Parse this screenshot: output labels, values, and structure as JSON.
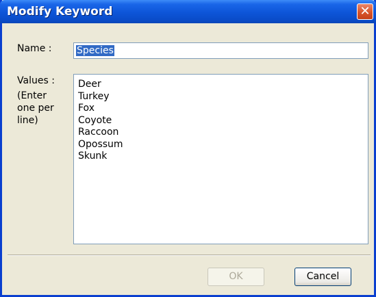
{
  "window": {
    "title": "Modify Keyword",
    "close_glyph": "✕"
  },
  "form": {
    "name_label": "Name :",
    "name_value": "Species",
    "values_label_line1": "Values :",
    "values_hint_line1": "(Enter",
    "values_hint_line2": "one per",
    "values_hint_line3": "line)",
    "values": [
      "Deer",
      "Turkey",
      "Fox",
      "Coyote",
      "Raccoon",
      "Opossum",
      "Skunk"
    ]
  },
  "buttons": {
    "ok_label": "OK",
    "ok_enabled": false,
    "cancel_label": "Cancel"
  }
}
